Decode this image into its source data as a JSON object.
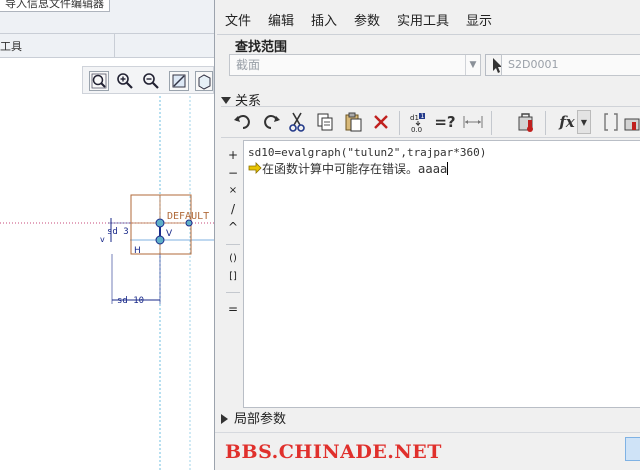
{
  "background_window": {
    "title_fragment": "导入信息文件编辑器",
    "toolbar_label": "工具"
  },
  "sketch": {
    "label_default": "DEFAULT",
    "dim_sd3": "sd 3",
    "dim_sd10": "sd 10",
    "label_v": "V",
    "label_h": "H",
    "label_v_small": "v"
  },
  "dialog": {
    "menus": [
      "文件",
      "编辑",
      "插入",
      "参数",
      "实用工具",
      "显示"
    ],
    "scope": {
      "title": "查找范围",
      "selected": "截面",
      "field_value": "S2D0001"
    },
    "relations_header": "关系",
    "toolbar_icons": [
      "undo-icon",
      "redo-icon",
      "cut-icon",
      "copy-icon",
      "paste-icon",
      "delete-icon",
      "show-values-icon",
      "evaluate-icon",
      "measure-icon",
      "units-icon",
      "function-icon",
      "dropdown-icon",
      "bracket-icon",
      "color-icon"
    ],
    "toolbar_text": {
      "evaluate": "=?",
      "function": "fx"
    },
    "operators": [
      "+",
      "−",
      "×",
      "/",
      "^",
      "()",
      "[]",
      "="
    ],
    "editor": {
      "line1": "sd10=evalgraph(\"tulun2\",trajpar*360)",
      "line2": "在函数计算中可能存在错误。aaaa"
    },
    "local_params": "局部参数",
    "watermark": "BBS.CHINADE.NET"
  },
  "colors": {
    "watermark": "#e0302c",
    "dimension": "#1a2a8a",
    "sketch_box": "#b06a3a",
    "ref_line": "#6fbfe0",
    "error_arrow": "#e8c400"
  }
}
